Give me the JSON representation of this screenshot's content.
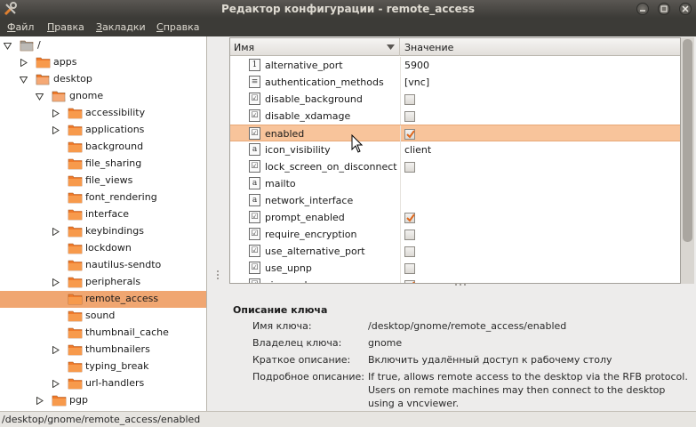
{
  "window": {
    "title": "Редактор конфигурации - remote_access"
  },
  "menu": [
    {
      "pre": "",
      "ul": "Ф",
      "post": "айл"
    },
    {
      "pre": "",
      "ul": "П",
      "post": "равка"
    },
    {
      "pre": "",
      "ul": "З",
      "post": "акладки"
    },
    {
      "pre": "",
      "ul": "С",
      "post": "правка"
    }
  ],
  "tree": {
    "items": [
      {
        "label": "/",
        "level": 0,
        "expander": "expanded",
        "selected": false
      },
      {
        "label": "apps",
        "level": 1,
        "expander": "collapsed",
        "selected": false
      },
      {
        "label": "desktop",
        "level": 1,
        "expander": "expanded",
        "selected": false
      },
      {
        "label": "gnome",
        "level": 2,
        "expander": "expanded",
        "selected": false
      },
      {
        "label": "accessibility",
        "level": 3,
        "expander": "collapsed",
        "selected": false
      },
      {
        "label": "applications",
        "level": 3,
        "expander": "collapsed",
        "selected": false
      },
      {
        "label": "background",
        "level": 3,
        "expander": "none",
        "selected": false
      },
      {
        "label": "file_sharing",
        "level": 3,
        "expander": "none",
        "selected": false
      },
      {
        "label": "file_views",
        "level": 3,
        "expander": "none",
        "selected": false
      },
      {
        "label": "font_rendering",
        "level": 3,
        "expander": "none",
        "selected": false
      },
      {
        "label": "interface",
        "level": 3,
        "expander": "none",
        "selected": false
      },
      {
        "label": "keybindings",
        "level": 3,
        "expander": "collapsed",
        "selected": false
      },
      {
        "label": "lockdown",
        "level": 3,
        "expander": "none",
        "selected": false
      },
      {
        "label": "nautilus-sendto",
        "level": 3,
        "expander": "none",
        "selected": false
      },
      {
        "label": "peripherals",
        "level": 3,
        "expander": "collapsed",
        "selected": false
      },
      {
        "label": "remote_access",
        "level": 3,
        "expander": "none",
        "selected": true
      },
      {
        "label": "sound",
        "level": 3,
        "expander": "none",
        "selected": false
      },
      {
        "label": "thumbnail_cache",
        "level": 3,
        "expander": "none",
        "selected": false
      },
      {
        "label": "thumbnailers",
        "level": 3,
        "expander": "collapsed",
        "selected": false
      },
      {
        "label": "typing_break",
        "level": 3,
        "expander": "none",
        "selected": false
      },
      {
        "label": "url-handlers",
        "level": 3,
        "expander": "collapsed",
        "selected": false
      },
      {
        "label": "pgp",
        "level": 2,
        "expander": "collapsed",
        "selected": false
      }
    ]
  },
  "list": {
    "header": {
      "name": "Имя",
      "value": "Значение"
    },
    "rows": [
      {
        "name": "alternative_port",
        "icon": "1",
        "type": "text",
        "value": "5900",
        "selected": false
      },
      {
        "name": "authentication_methods",
        "icon": "list",
        "type": "text",
        "value": "[vnc]",
        "selected": false
      },
      {
        "name": "disable_background",
        "icon": "check",
        "type": "bool",
        "value": false,
        "selected": false
      },
      {
        "name": "disable_xdamage",
        "icon": "check",
        "type": "bool",
        "value": false,
        "selected": false
      },
      {
        "name": "enabled",
        "icon": "check",
        "type": "bool",
        "value": true,
        "selected": true
      },
      {
        "name": "icon_visibility",
        "icon": "a",
        "type": "text",
        "value": "client",
        "selected": false
      },
      {
        "name": "lock_screen_on_disconnect",
        "icon": "check",
        "type": "bool",
        "value": false,
        "selected": false
      },
      {
        "name": "mailto",
        "icon": "a",
        "type": "text",
        "value": "",
        "selected": false
      },
      {
        "name": "network_interface",
        "icon": "a",
        "type": "text",
        "value": "",
        "selected": false
      },
      {
        "name": "prompt_enabled",
        "icon": "check",
        "type": "bool",
        "value": true,
        "selected": false
      },
      {
        "name": "require_encryption",
        "icon": "check",
        "type": "bool",
        "value": false,
        "selected": false
      },
      {
        "name": "use_alternative_port",
        "icon": "check",
        "type": "bool",
        "value": false,
        "selected": false
      },
      {
        "name": "use_upnp",
        "icon": "check",
        "type": "bool",
        "value": false,
        "selected": false
      },
      {
        "name": "view_only",
        "icon": "check",
        "type": "bool",
        "value": true,
        "selected": false
      }
    ]
  },
  "description": {
    "title": "Описание ключа",
    "key_name_label": "Имя ключа:",
    "key_name": "/desktop/gnome/remote_access/enabled",
    "owner_label": "Владелец ключа:",
    "owner": "gnome",
    "short_label": "Краткое описание:",
    "short": "Включить удалённый доступ к рабочему столу",
    "long_label": "Подробное описание:",
    "long_lines": [
      "If true, allows remote access to the desktop via the RFB protocol.",
      "Users on remote machines may then connect to the desktop",
      "using a vncviewer."
    ]
  },
  "statusbar": {
    "text": "/desktop/gnome/remote_access/enabled"
  },
  "colors": {
    "selection": "#f0a671",
    "row_highlight": "#f8c49b",
    "check": "#e0681c",
    "folder": "#f07a2a"
  }
}
